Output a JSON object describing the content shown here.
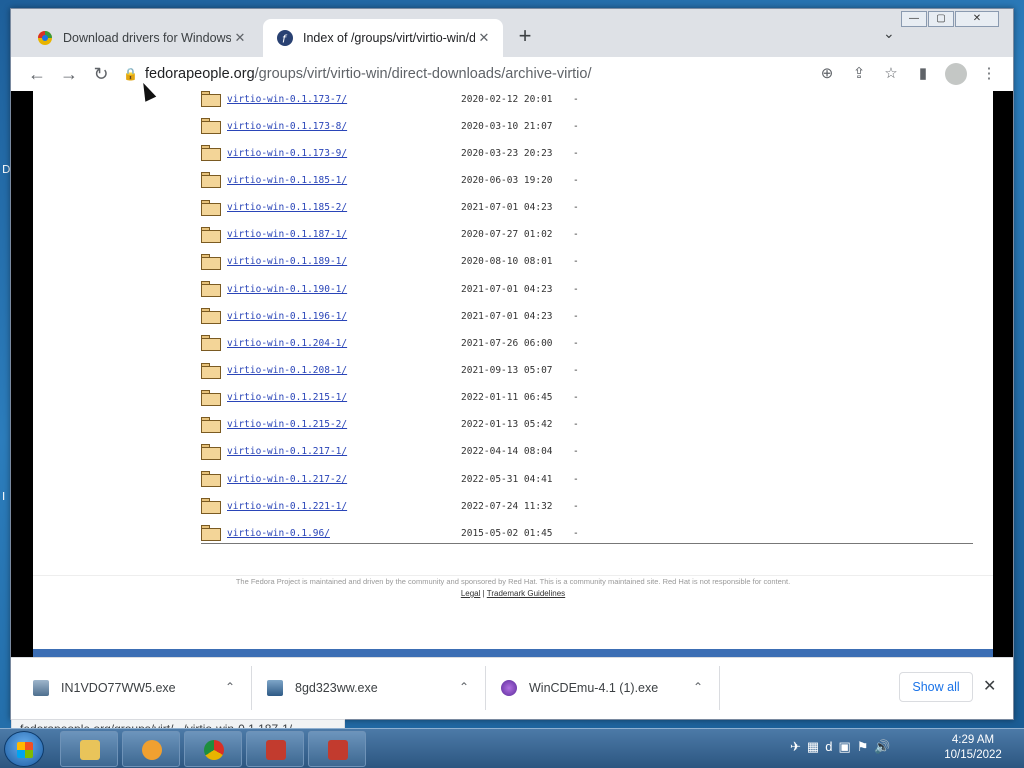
{
  "desktop": {
    "left_glyphs": [
      "D",
      "I"
    ]
  },
  "tabs": [
    {
      "title": "Download drivers for Windows 7",
      "close": "✕",
      "favicon": "chrome-like-icon"
    },
    {
      "title": "Index of /groups/virt/virtio-win/d",
      "close": "✕",
      "favicon": "fedora-icon"
    }
  ],
  "newtab_label": "+",
  "window_controls": {
    "minimize": "—",
    "maximize": "▢",
    "close": "✕"
  },
  "toolbar": {
    "back": "←",
    "forward": "→",
    "reload": "↻"
  },
  "address": {
    "host": "fedorapeople.org",
    "path": "/groups/virt/virtio-win/direct-downloads/archive-virtio/"
  },
  "listing": [
    {
      "name": "virtio-win-0.1.173-7/",
      "date": "2020-02-12 20:01",
      "size": "-"
    },
    {
      "name": "virtio-win-0.1.173-8/",
      "date": "2020-03-10 21:07",
      "size": "-"
    },
    {
      "name": "virtio-win-0.1.173-9/",
      "date": "2020-03-23 20:23",
      "size": "-"
    },
    {
      "name": "virtio-win-0.1.185-1/",
      "date": "2020-06-03 19:20",
      "size": "-"
    },
    {
      "name": "virtio-win-0.1.185-2/",
      "date": "2021-07-01 04:23",
      "size": "-"
    },
    {
      "name": "virtio-win-0.1.187-1/",
      "date": "2020-07-27 01:02",
      "size": "-"
    },
    {
      "name": "virtio-win-0.1.189-1/",
      "date": "2020-08-10 08:01",
      "size": "-"
    },
    {
      "name": "virtio-win-0.1.190-1/",
      "date": "2021-07-01 04:23",
      "size": "-"
    },
    {
      "name": "virtio-win-0.1.196-1/",
      "date": "2021-07-01 04:23",
      "size": "-"
    },
    {
      "name": "virtio-win-0.1.204-1/",
      "date": "2021-07-26 06:00",
      "size": "-"
    },
    {
      "name": "virtio-win-0.1.208-1/",
      "date": "2021-09-13 05:07",
      "size": "-"
    },
    {
      "name": "virtio-win-0.1.215-1/",
      "date": "2022-01-11 06:45",
      "size": "-"
    },
    {
      "name": "virtio-win-0.1.215-2/",
      "date": "2022-01-13 05:42",
      "size": "-"
    },
    {
      "name": "virtio-win-0.1.217-1/",
      "date": "2022-04-14 08:04",
      "size": "-"
    },
    {
      "name": "virtio-win-0.1.217-2/",
      "date": "2022-05-31 04:41",
      "size": "-"
    },
    {
      "name": "virtio-win-0.1.221-1/",
      "date": "2022-07-24 11:32",
      "size": "-"
    },
    {
      "name": "virtio-win-0.1.96/",
      "date": "2015-05-02 01:45",
      "size": "-"
    }
  ],
  "footer": {
    "text": "The Fedora Project is maintained and driven by the community and sponsored by Red Hat. This is a community maintained site. Red Hat is not responsible for content.",
    "legal": "Legal",
    "separator": "|",
    "trademark": "Trademark Guidelines"
  },
  "status_url": "fedorapeople.org/groups/virt/.../virtio-win-0.1.187-1/",
  "downloads": [
    {
      "name": "IN1VDO77WW5.exe",
      "icon": "installer-icon",
      "chevron": "⌃"
    },
    {
      "name": "8gd323ww.exe",
      "icon": "setup-icon",
      "chevron": "⌃"
    },
    {
      "name": "WinCDEmu-4.1 (1).exe",
      "icon": "wincdemu-icon",
      "chevron": "⌃"
    }
  ],
  "show_all": "Show all",
  "shelf_close": "✕",
  "clock": {
    "time": "4:29 AM",
    "date": "10/15/2022"
  },
  "colors": {
    "link": "#2a45b8",
    "fedora_blue": "#3c6eb4",
    "chrome_accent": "#1a73e8"
  }
}
